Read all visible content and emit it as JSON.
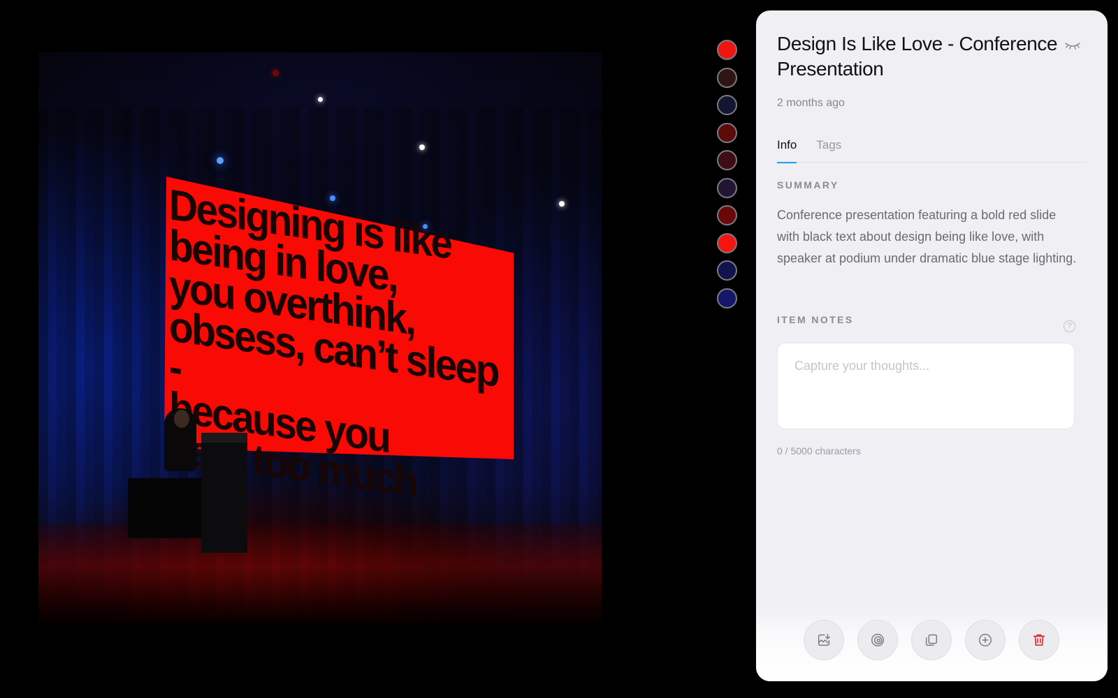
{
  "photo": {
    "slide_lines": [
      "Designing is like",
      "being in love,",
      "you overthink,",
      "obsess, can’t sleep -",
      "because you",
      "care too much"
    ]
  },
  "swatches": [
    {
      "color": "#f01510"
    },
    {
      "color": "#2e1413"
    },
    {
      "color": "#141530"
    },
    {
      "color": "#5d0a0a"
    },
    {
      "color": "#3e0c12"
    },
    {
      "color": "#241433"
    },
    {
      "color": "#6a0808"
    },
    {
      "color": "#f41510"
    },
    {
      "color": "#10144a"
    },
    {
      "color": "#15186a"
    }
  ],
  "panel": {
    "title": "Design Is Like Love - Conference Presentation",
    "date": "2 months ago",
    "tabs": [
      {
        "label": "Info",
        "active": true
      },
      {
        "label": "Tags",
        "active": false
      }
    ],
    "summary_label": "SUMMARY",
    "summary": "Conference presentation featuring a bold red slide with black text about design being like love, with speaker at podium under dramatic blue stage lighting.",
    "notes_label": "ITEM NOTES",
    "help_glyph": "?",
    "notes_placeholder": "Capture your thoughts...",
    "notes_value": "",
    "char_counter": "0 / 5000 characters",
    "actions": [
      {
        "icon": "download-image-icon"
      },
      {
        "icon": "spiral-icon"
      },
      {
        "icon": "copy-icon"
      },
      {
        "icon": "add-circle-icon"
      },
      {
        "icon": "trash-icon",
        "color": "#e02a2a"
      }
    ]
  },
  "colors": {
    "accent": "#1ba0e6",
    "panel_bg": "#efeff4",
    "slide_red": "#fa0a05",
    "delete_red": "#e02a2a"
  }
}
